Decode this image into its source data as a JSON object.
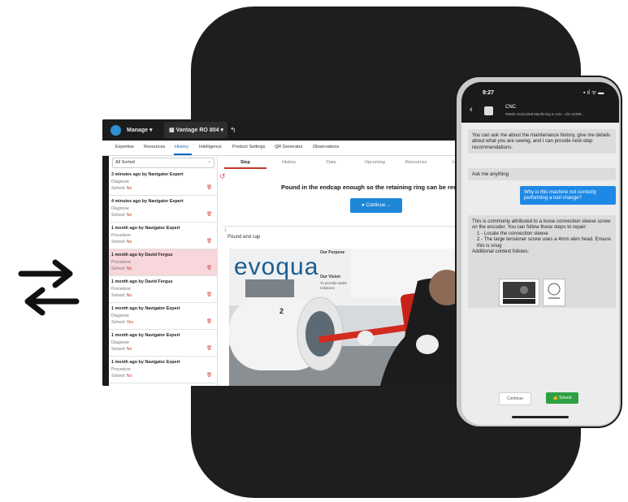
{
  "desktop": {
    "topbar": {
      "manage": "Manage",
      "machine": "Vantage RO 804"
    },
    "tabs": [
      {
        "label": "Expertise"
      },
      {
        "label": "Resources"
      },
      {
        "label": "History",
        "active": true
      },
      {
        "label": "Intelligence"
      },
      {
        "label": "Product Settings"
      },
      {
        "label": "QR Generator"
      },
      {
        "label": "Observations"
      }
    ],
    "filter": {
      "value": "All Sorted"
    },
    "history_items": [
      {
        "title": "3 minutes ago by Navigator Expert",
        "category": "Diagnose",
        "result_label": "Solved:",
        "result_value": "No"
      },
      {
        "title": "4 minutes ago by Navigator Expert",
        "category": "Diagnose",
        "result_label": "Solved:",
        "result_value": "No"
      },
      {
        "title": "1 month ago by Navigator Expert",
        "category": "Procedure",
        "result_label": "Solved:",
        "result_value": "No"
      },
      {
        "title": "1 month ago by David Fergus",
        "category": "Procedure",
        "result_label": "Solved:",
        "result_value": "No",
        "highlighted": true
      },
      {
        "title": "1 month ago by David Fergus",
        "category": "Procedure",
        "result_label": "Solved:",
        "result_value": "No"
      },
      {
        "title": "1 month ago by Navigator Expert",
        "category": "Diagnose",
        "result_label": "Solved:",
        "result_value": "Yes"
      },
      {
        "title": "1 month ago by Navigator Expert",
        "category": "Diagnose",
        "result_label": "Solved:",
        "result_value": "No"
      },
      {
        "title": "1 month ago by Navigator Expert",
        "category": "Procedure",
        "result_label": "Solved:",
        "result_value": "No"
      }
    ],
    "subtabs": [
      "Step",
      "History",
      "Data",
      "Upcoming",
      "Resources",
      "He"
    ],
    "instruction": "Pound in the endcap enough so the retaining ring can be remo",
    "continue_label": "Continue ...",
    "section_number": "1",
    "section_title": "Pound end cap",
    "photo_brand": "evoqua",
    "photo_banner_title": "Our Purpose",
    "photo_banner_vision": "Our Vision",
    "photo_banner_line1": "To provide water",
    "photo_banner_line2": "solutions",
    "photo_number": "2"
  },
  "phone": {
    "time": "9:27",
    "status": "▪ ıl ᯤ ▬",
    "chat_name": "CNC",
    "chat_subtitle": "#5002 Horizontal Machining 5-Axis - s/2-12406...",
    "messages": [
      {
        "role": "bot",
        "text": "You can ask me about the maintenance history, give me details about what you are seeing, and I can provide next-step recommendations."
      },
      {
        "role": "bot",
        "text": "Ask me anything"
      },
      {
        "role": "user",
        "text": "Why is this machine not correctly performing a tool change?"
      },
      {
        "role": "bot",
        "text": "This is commonly attributed to a loose connection sleeve screw on the encoder. You can follow these steps to repair:",
        "steps": [
          "1 - Locate the connection sleeve",
          "2 - The large tensioner screw uses a 4mm alen head. Ensure this is snug"
        ],
        "footer": "Additional context follows:"
      }
    ],
    "continue_label": "Continue",
    "solved_label": "Solved"
  },
  "colors": {
    "accent_blue": "#1e88d8",
    "highlight_row": "#f7d6dc",
    "solved_green": "#2ea043",
    "backdrop": "#1e1e1e"
  }
}
